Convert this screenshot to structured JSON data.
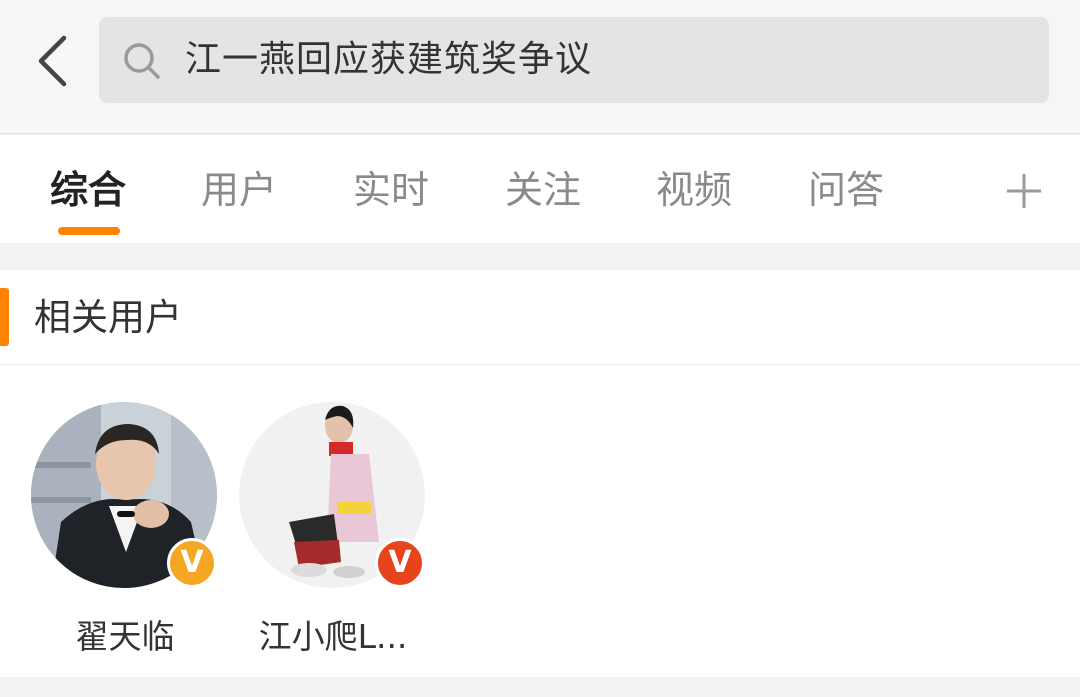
{
  "search": {
    "query": "江一燕回应获建筑奖争议"
  },
  "tabs": [
    {
      "label": "综合",
      "active": true
    },
    {
      "label": "用户",
      "active": false
    },
    {
      "label": "实时",
      "active": false
    },
    {
      "label": "关注",
      "active": false
    },
    {
      "label": "视频",
      "active": false
    },
    {
      "label": "问答",
      "active": false
    }
  ],
  "related_users": {
    "title": "相关用户",
    "users": [
      {
        "name": "翟天临",
        "badge": "V",
        "badge_color": "#f5a623"
      },
      {
        "name": "江小爬L...",
        "badge": "V",
        "badge_color": "#e8441c"
      }
    ]
  },
  "colors": {
    "accent": "#ff8200"
  }
}
